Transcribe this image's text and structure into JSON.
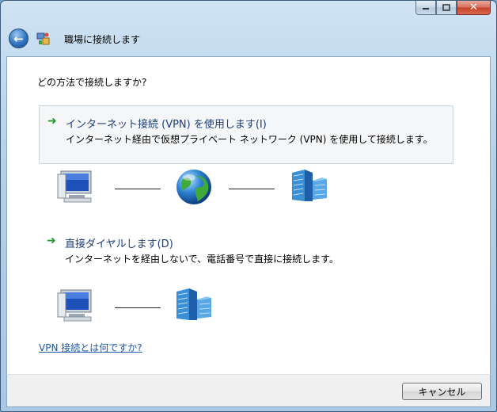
{
  "window": {
    "title": "職場に接続します"
  },
  "caption_buttons": {
    "minimize_icon": "minimize-icon",
    "maximize_icon": "maximize-icon",
    "close_label": "✕"
  },
  "content": {
    "question": "どの方法で接続しますか?",
    "options": [
      {
        "title": "インターネット接続 (VPN) を使用します(I)",
        "description": "インターネット経由で仮想プライベート ネットワーク (VPN) を使用して接続します。",
        "icons": [
          "computer-icon",
          "globe-icon",
          "office-building-icon"
        ]
      },
      {
        "title": "直接ダイヤルします(D)",
        "description": "インターネットを経由しないで、電話番号で直接に接続します。",
        "icons": [
          "computer-icon",
          "office-building-icon"
        ]
      }
    ],
    "help_link": "VPN 接続とは何ですか?"
  },
  "footer": {
    "cancel_label": "キャンセル"
  },
  "colors": {
    "option_title": "#1e3d78",
    "link": "#1f56a8",
    "arrow": "#1c9a2a"
  }
}
